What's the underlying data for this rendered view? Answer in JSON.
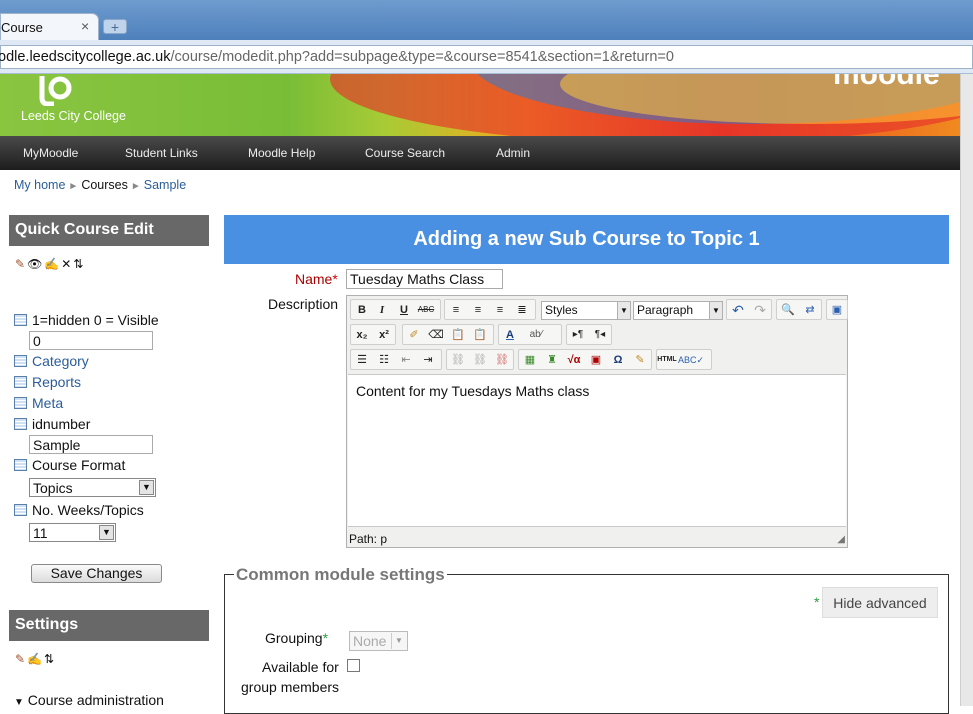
{
  "browser": {
    "tab_title": "Course",
    "tab_close": "×",
    "new_tab": "+",
    "url_host": "odle.leedscitycollege.ac.uk",
    "url_path": "/course/modedit.php?add=subpage&type=&course=8541&section=1&return=0"
  },
  "banner": {
    "college_name": "Leeds City College",
    "brand": "moodle"
  },
  "nav": [
    "MyMoodle",
    "Student Links",
    "Moodle Help",
    "Course Search",
    "Admin"
  ],
  "breadcrumb": [
    "My home",
    "Courses",
    "Sample"
  ],
  "quick_edit": {
    "title": "Quick Course Edit",
    "icons": [
      "edit-icon",
      "eye-icon",
      "hand-icon",
      "delete-icon",
      "move-icon"
    ],
    "visible_label": "1=hidden 0 = Visible",
    "visible_value": "0",
    "category_label": "Category",
    "reports_label": "Reports",
    "meta_label": "Meta",
    "idnumber_label": "idnumber",
    "idnumber_value": "Sample",
    "format_label": "Course Format",
    "format_value": "Topics",
    "weeks_label": "No. Weeks/Topics",
    "weeks_value": "11",
    "save_label": "Save Changes"
  },
  "settings": {
    "title": "Settings",
    "icons": [
      "edit-icon",
      "hand-icon",
      "move-icon"
    ],
    "course_admin_label": "Course administration"
  },
  "form": {
    "title": "Adding a new Sub Course to Topic 1",
    "name_label": "Name",
    "required_mark": "*",
    "name_value": "Tuesday Maths Class",
    "description_label": "Description",
    "styles_select": "Styles",
    "format_select": "Paragraph",
    "editor_content": "Content for my Tuesdays Maths class",
    "path": "Path: p"
  },
  "common": {
    "legend": "Common module settings",
    "hide_advanced": "Hide advanced",
    "grouping_label": "Grouping",
    "grouping_value": "None",
    "available_label_1": "Available for",
    "available_label_2": "group members"
  }
}
